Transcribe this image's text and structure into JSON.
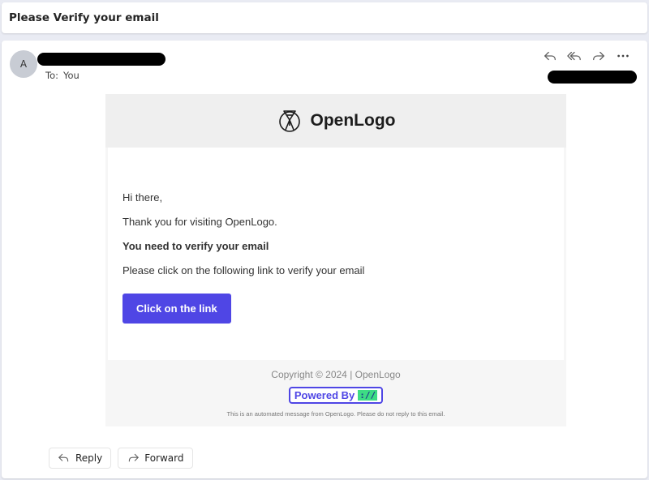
{
  "subject": "Please Verify your email",
  "sender": {
    "avatar_initial": "A",
    "to_label": "To:",
    "to_value": "You"
  },
  "actions": [
    "reply-icon",
    "reply-all-icon",
    "forward-icon",
    "more-icon"
  ],
  "email": {
    "brand": "OpenLogo",
    "greeting": "Hi there,",
    "thanks": "Thank you for visiting OpenLogo.",
    "verify_heading": "You need to verify your email",
    "instruction": "Please click on the following link to verify your email",
    "cta_label": "Click on the link",
    "copyright": "Copyright © 2024 | OpenLogo",
    "powered_by": "Powered By",
    "powered_chip": "://",
    "automated_note": "This is an automated message from OpenLogo. Please do not reply to this email."
  },
  "reply_bar": {
    "reply": "Reply",
    "forward": "Forward"
  },
  "colors": {
    "accent": "#4f46e5",
    "chip": "#3ddc84",
    "background": "#e9ebf3"
  }
}
